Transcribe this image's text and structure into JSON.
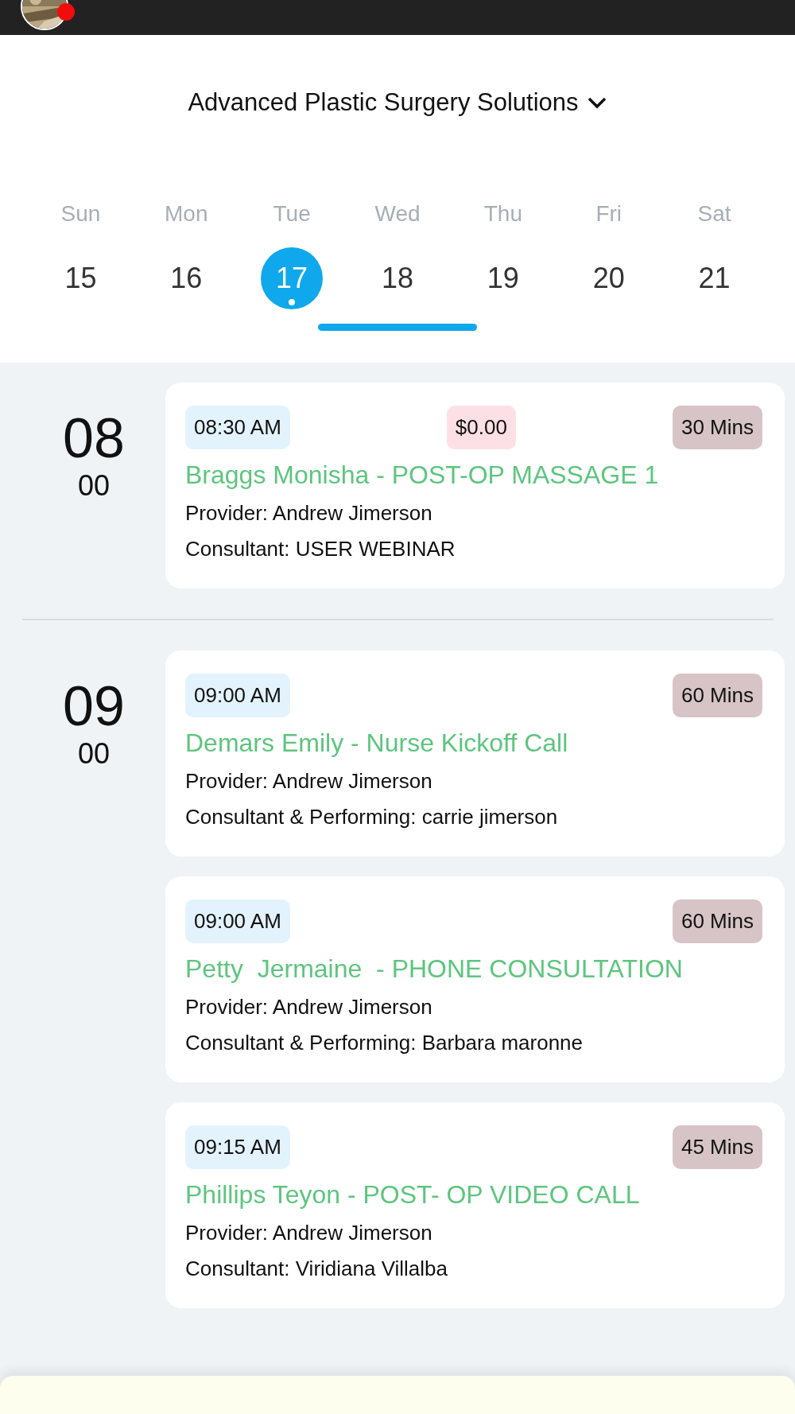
{
  "header": {
    "clinic": "Advanced Plastic Surgery Solutions",
    "notification": true
  },
  "week": [
    {
      "weekday": "Sun",
      "date": "15",
      "selected": false,
      "underlined": false
    },
    {
      "weekday": "Mon",
      "date": "16",
      "selected": false,
      "underlined": false
    },
    {
      "weekday": "Tue",
      "date": "17",
      "selected": true,
      "has_event": true,
      "underlined": false
    },
    {
      "weekday": "Wed",
      "date": "18",
      "selected": false,
      "underlined": true
    },
    {
      "weekday": "Thu",
      "date": "19",
      "selected": false,
      "underlined": false
    },
    {
      "weekday": "Fri",
      "date": "20",
      "selected": false,
      "underlined": false
    },
    {
      "weekday": "Sat",
      "date": "21",
      "selected": false,
      "underlined": false
    }
  ],
  "hours": [
    {
      "hour": "08",
      "minute": "00",
      "appointments": [
        {
          "time": "08:30 AM",
          "price": "$0.00",
          "duration": "30 Mins",
          "title": "Braggs Monisha - POST-OP MASSAGE 1",
          "lines": [
            "Provider: Andrew Jimerson",
            "Consultant: USER WEBINAR"
          ]
        }
      ]
    },
    {
      "hour": "09",
      "minute": "00",
      "appointments": [
        {
          "time": "09:00 AM",
          "duration": "60 Mins",
          "title": "Demars Emily - Nurse Kickoff Call",
          "lines": [
            "Provider: Andrew Jimerson",
            "Consultant & Performing: carrie jimerson"
          ]
        },
        {
          "time": "09:00 AM",
          "duration": "60 Mins",
          "title": "Petty  Jermaine  - PHONE CONSULTATION",
          "lines": [
            "Provider: Andrew Jimerson",
            "Consultant & Performing: Barbara maronne"
          ]
        },
        {
          "time": "09:15 AM",
          "duration": "45 Mins",
          "title": "Phillips Teyon - POST- OP VIDEO CALL",
          "lines": [
            "Provider: Andrew Jimerson",
            "Consultant: Viridiana Villalba"
          ]
        }
      ]
    }
  ]
}
